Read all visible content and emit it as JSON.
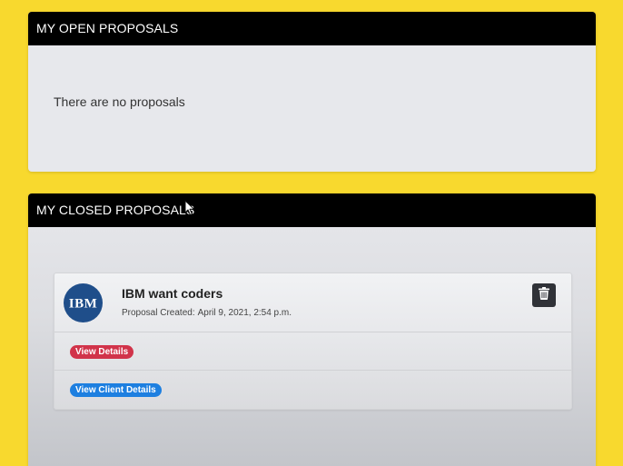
{
  "open_proposals": {
    "title": "MY OPEN PROPOSALS",
    "empty_message": "There are no proposals"
  },
  "closed_proposals": {
    "title": "MY CLOSED PROPOSALS",
    "items": [
      {
        "client_logo_text": "IBM",
        "title": "IBM want coders",
        "created_label": "Proposal Created:",
        "created_date": "April 9, 2021, 2:54 p.m.",
        "view_details_label": "View Details",
        "view_client_details_label": "View Client Details"
      }
    ]
  },
  "icons": {
    "delete": "trash-icon",
    "cursor": "mouse-pointer-icon"
  },
  "colors": {
    "background": "#f8d92e",
    "header": "#000000",
    "view_details": "#d1334a",
    "view_client_details": "#1d7fe0",
    "delete_button": "#303238"
  }
}
